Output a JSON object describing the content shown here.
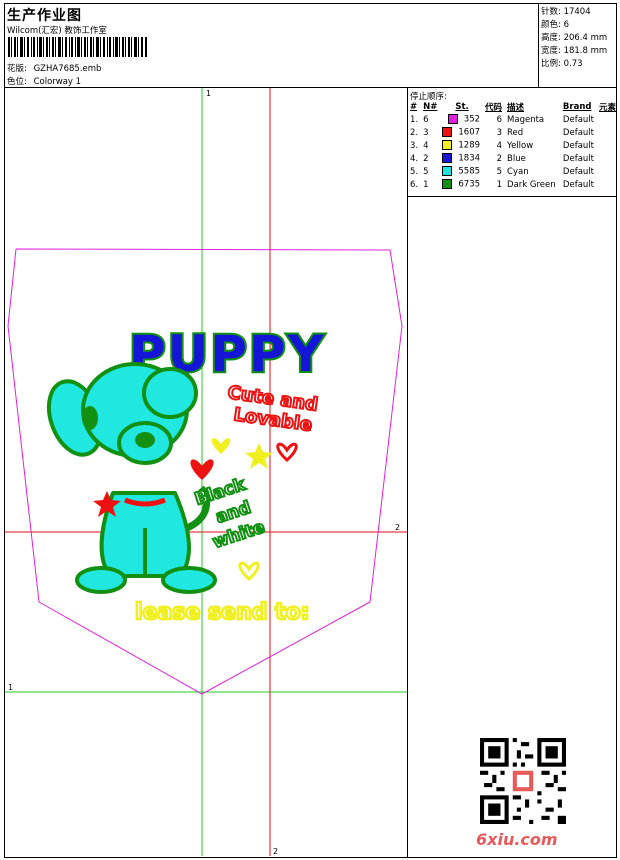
{
  "header": {
    "title": "生产作业图",
    "studio": "Wilcom(汇宏) 教饰工作室",
    "design_file_label": "花版:",
    "design_file": "GZHA7685.emb",
    "colorway_label": "色位:",
    "colorway": "Colorway 1"
  },
  "stats": [
    {
      "label": "针数:",
      "value": "17404"
    },
    {
      "label": "颜色:",
      "value": "6"
    },
    {
      "label": "高度:",
      "value": "206.4 mm"
    },
    {
      "label": "宽度:",
      "value": "181.8 mm"
    },
    {
      "label": "比例:",
      "value": "0.73"
    }
  ],
  "stop_sequence": {
    "heading": "停止顺序:",
    "columns": [
      "#",
      "N#",
      "St.",
      "代码",
      "描述",
      "Brand",
      "元素"
    ],
    "rows": [
      {
        "idx": "1.",
        "n": "6",
        "color": "#e020e0",
        "st": "352",
        "code": "6",
        "desc": "Magenta",
        "brand": "Default"
      },
      {
        "idx": "2.",
        "n": "3",
        "color": "#ee1111",
        "st": "1607",
        "code": "3",
        "desc": "Red",
        "brand": "Default"
      },
      {
        "idx": "3.",
        "n": "4",
        "color": "#f0f020",
        "st": "1289",
        "code": "4",
        "desc": "Yellow",
        "brand": "Default"
      },
      {
        "idx": "4.",
        "n": "2",
        "color": "#1515d8",
        "st": "1834",
        "code": "2",
        "desc": "Blue",
        "brand": "Default"
      },
      {
        "idx": "5.",
        "n": "5",
        "color": "#20e0e0",
        "st": "5585",
        "code": "5",
        "desc": "Cyan",
        "brand": "Default"
      },
      {
        "idx": "6.",
        "n": "1",
        "color": "#129012",
        "st": "6735",
        "code": "1",
        "desc": "Dark Green",
        "brand": "Default"
      }
    ]
  },
  "design": {
    "puppy_text": "PUPPY",
    "cute_text": "Cute and",
    "lovable_text": "Lovable",
    "black_text": "Black",
    "and_text": "and",
    "white_text": "white",
    "send_text": "lease send to:",
    "guide_markers": [
      "1",
      "2",
      "2",
      "1"
    ]
  },
  "watermark": "6xiu.com",
  "colors": {
    "magenta": "#e020e0",
    "red": "#ee1111",
    "yellow": "#f0f020",
    "blue": "#1515d8",
    "cyan": "#20e8e0",
    "green": "#129012",
    "guide_green": "#22cc22",
    "guide_red": "#dd1111"
  }
}
